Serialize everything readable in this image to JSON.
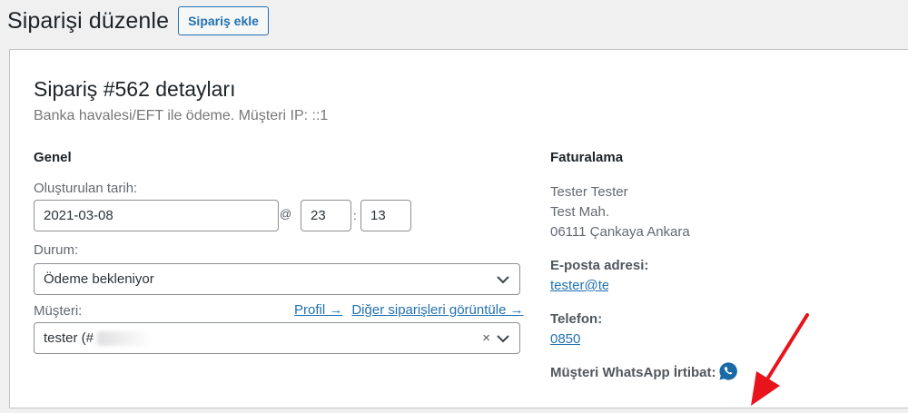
{
  "header": {
    "title": "Siparişi düzenle",
    "add_button": "Sipariş ekle"
  },
  "order": {
    "heading": "Sipariş #562 detayları",
    "meta": "Banka havalesi/EFT ile ödeme. Müşteri IP: ::1"
  },
  "general": {
    "title": "Genel",
    "date_label": "Oluşturulan tarih:",
    "date_value": "2021-03-08",
    "at_sign": "@",
    "hour": "23",
    "colon": ":",
    "minute": "13",
    "status_label": "Durum:",
    "status_value": "Ödeme bekleniyor",
    "customer_label": "Müşteri:",
    "profile_link": "Profil →",
    "other_orders_link": "Diğer siparişleri görüntüle →",
    "customer_value": "tester (#",
    "clear_symbol": "×"
  },
  "billing": {
    "title": "Faturalama",
    "address_lines": [
      "Tester Tester",
      "Test Mah.",
      "06111 Çankaya Ankara"
    ],
    "email_label": "E-posta adresi:",
    "email_value": "tester@te",
    "phone_label": "Telefon:",
    "phone_value": "0850",
    "whatsapp_label": "Müşteri WhatsApp İrtibat:"
  },
  "colors": {
    "accent": "#2271b1",
    "whatsapp_icon": "#1b6aa8",
    "annotation_arrow": "#e8141c"
  },
  "icons": {
    "whatsapp": "whatsapp-icon",
    "select_arrow": "chevron-down-icon",
    "annotation": "red-arrow"
  }
}
